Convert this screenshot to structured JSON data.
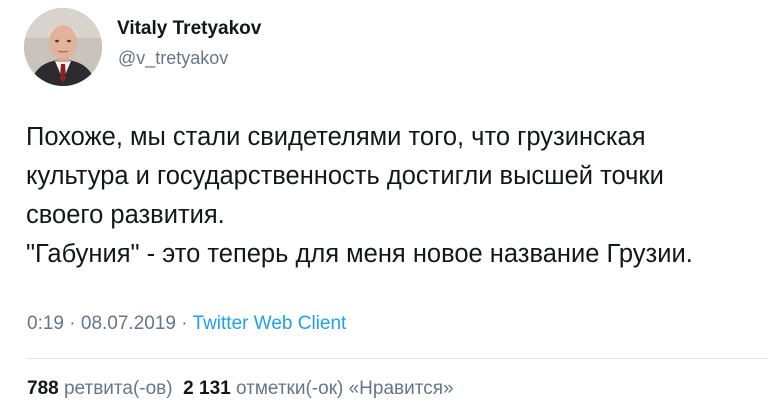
{
  "author": {
    "name": "Vitaly Tretyakov",
    "handle": "@v_tretyakov",
    "avatar_icon": "avatar-photo"
  },
  "tweet": {
    "lines": [
      "Похоже, мы стали свидетелями того, что грузинская",
      "культура и государственность достигли высшей точки",
      "своего развития.",
      "\"Габуния\" - это теперь для меня новое название Грузии."
    ],
    "time": "0:19",
    "separator": "·",
    "date": "08.07.2019",
    "client": "Twitter Web Client"
  },
  "stats": {
    "retweets_count": "788",
    "retweets_label": "ретвита(-ов)",
    "likes_count": "2 131",
    "likes_label": "отметки(-ок) «Нравится»"
  },
  "colors": {
    "text": "#14171a",
    "secondary": "#657786",
    "link": "#1da1f2",
    "divider": "#e1e8ed"
  }
}
